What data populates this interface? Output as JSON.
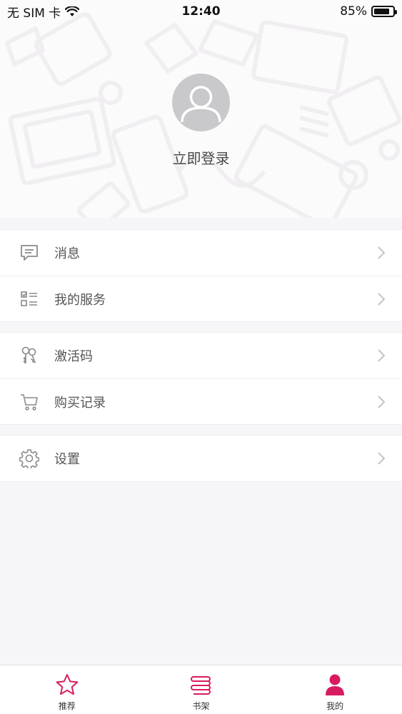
{
  "status_bar": {
    "carrier": "无 SIM 卡",
    "time": "12:40",
    "battery_percent": "85%",
    "battery_level": 0.85
  },
  "profile": {
    "login_label": "立即登录"
  },
  "menu": {
    "group1": [
      {
        "label": "消息",
        "icon": "message-icon"
      },
      {
        "label": "我的服务",
        "icon": "service-list-icon"
      }
    ],
    "group2": [
      {
        "label": "激活码",
        "icon": "key-icon"
      },
      {
        "label": "购买记录",
        "icon": "cart-icon"
      }
    ],
    "group3": [
      {
        "label": "设置",
        "icon": "gear-icon"
      }
    ]
  },
  "tab_bar": {
    "tabs": [
      {
        "label": "推荐",
        "icon": "star-icon"
      },
      {
        "label": "书架",
        "icon": "bookshelf-icon"
      },
      {
        "label": "我的",
        "icon": "user-icon",
        "active": true
      }
    ]
  },
  "colors": {
    "accent": "#d81b60",
    "chevron": "#c4c4c8",
    "icon_gray": "#8a8a8e"
  }
}
